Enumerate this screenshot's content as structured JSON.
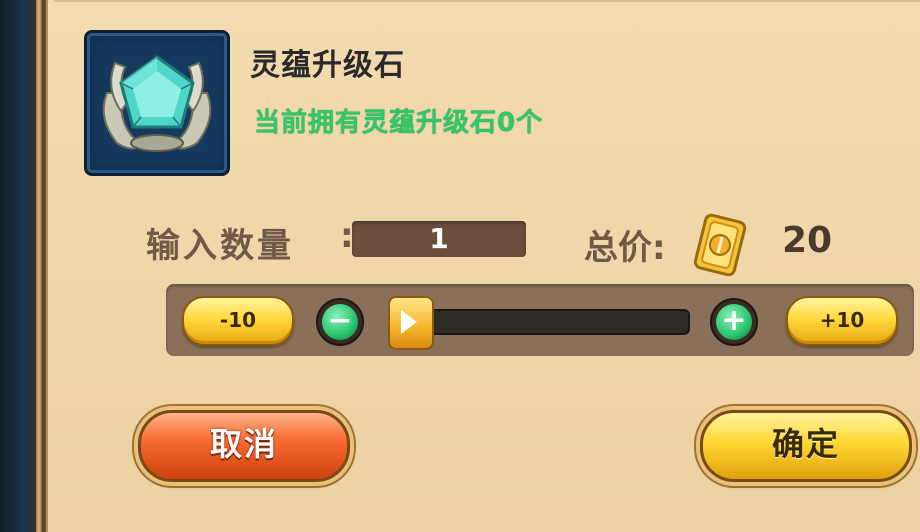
{
  "item": {
    "name": "灵蕴升级石",
    "owned_text": "当前拥有灵蕴升级石0个",
    "icon": "crystal-gem-icon"
  },
  "quantity": {
    "label": "输入数量",
    "colon": ":",
    "value": "1"
  },
  "price": {
    "label": "总价:",
    "currency_icon": "gold-ticket-icon",
    "value": "20"
  },
  "slider": {
    "minus10_label": "-10",
    "plus10_label": "+10",
    "decrement_symbol": "−",
    "increment_symbol": "+",
    "position_fraction": 0.0
  },
  "buttons": {
    "cancel_label": "取消",
    "confirm_label": "确定"
  },
  "colors": {
    "owned_text": "#2fc86a",
    "panel": "#f3dbb0",
    "cancel": "#f86d33",
    "confirm": "#ffd834"
  }
}
